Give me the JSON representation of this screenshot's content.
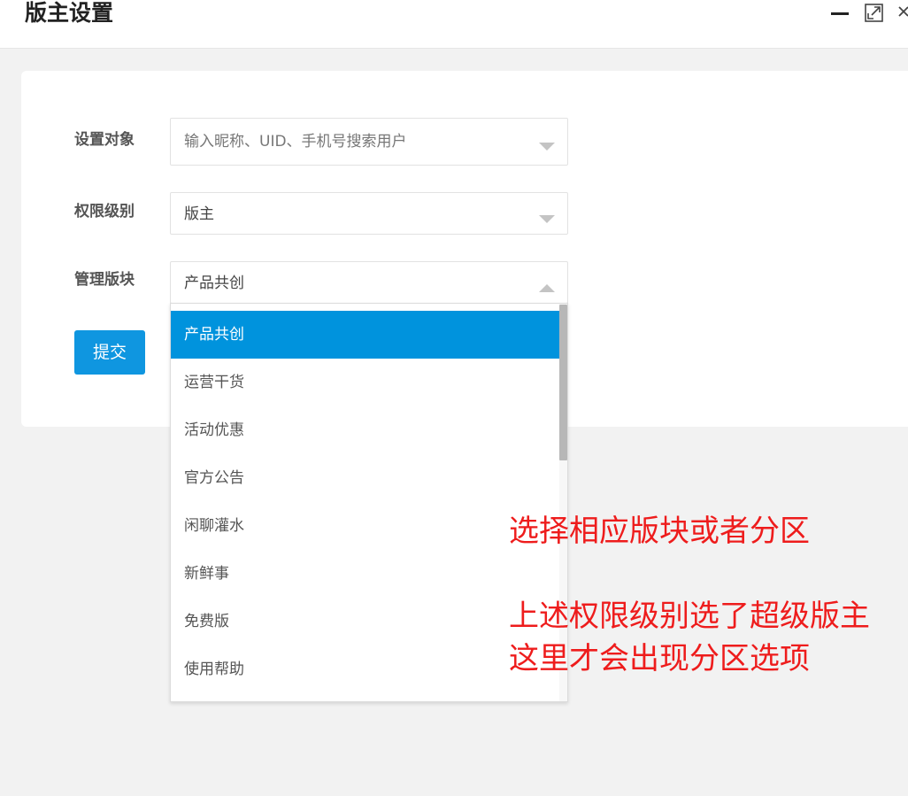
{
  "window": {
    "title": "版主设置",
    "controls": {
      "minimize_icon": "minimize-icon",
      "maximize_icon": "maximize-icon",
      "close_icon": "close-icon"
    }
  },
  "form": {
    "target_label": "设置对象",
    "target_placeholder": "输入昵称、UID、手机号搜索用户",
    "level_label": "权限级别",
    "level_value": "版主",
    "section_label": "管理版块",
    "section_value": "产品共创",
    "submit_label": "提交"
  },
  "dropdown": {
    "options": [
      "产品共创",
      "运营干货",
      "活动优惠",
      "官方公告",
      "闲聊灌水",
      "新鲜事",
      "免费版",
      "使用帮助"
    ],
    "selected": "产品共创"
  },
  "annotation": {
    "line1": "选择相应版块或者分区",
    "line2": "上述权限级别选了超级版主",
    "line3": "这里才会出现分区选项",
    "color": "#ee1c1c"
  },
  "colors": {
    "accent": "#0093dd",
    "button": "#0f96e0",
    "background": "#f2f2f2"
  }
}
